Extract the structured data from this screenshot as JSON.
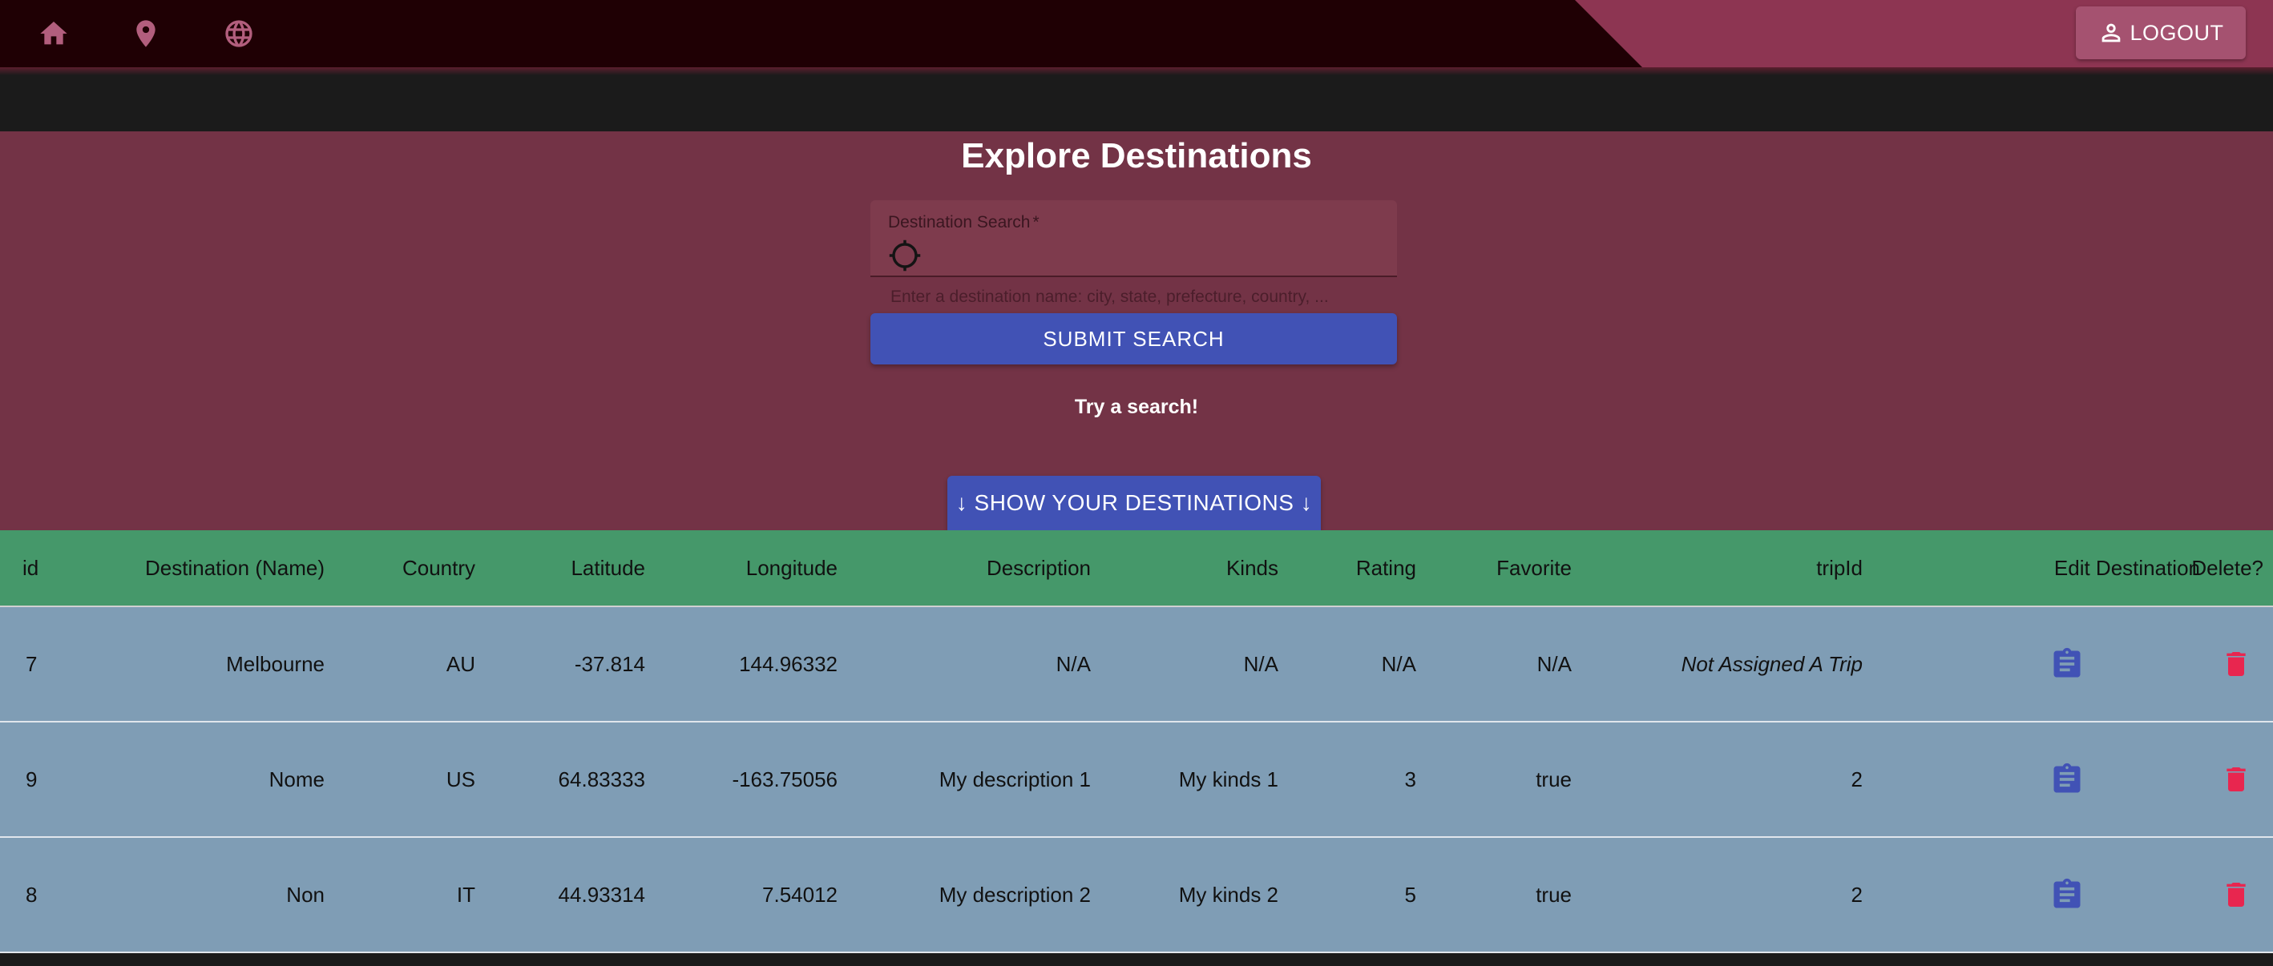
{
  "nav": {
    "icons": [
      "home-icon",
      "location-pin-icon",
      "globe-icon"
    ],
    "logout_label": "LOGOUT"
  },
  "explore": {
    "title": "Explore Destinations",
    "search": {
      "label": "Destination Search",
      "required_marker": "*",
      "value": "",
      "helper": "Enter a destination name: city, state, prefecture, country, ..."
    },
    "submit_label": "SUBMIT SEARCH",
    "status_text": "Try a search!",
    "show_button_label": "↓ SHOW YOUR DESTINATIONS ↓"
  },
  "table": {
    "headers": {
      "id": "id",
      "name": "Destination (Name)",
      "country": "Country",
      "latitude": "Latitude",
      "longitude": "Longitude",
      "description": "Description",
      "kinds": "Kinds",
      "rating": "Rating",
      "favorite": "Favorite",
      "trip": "tripId",
      "edit": "Edit Destination",
      "delete": "Delete?"
    },
    "rows": [
      {
        "id": "7",
        "name": "Melbourne",
        "country": "AU",
        "latitude": "-37.814",
        "longitude": "144.96332",
        "description": "N/A",
        "kinds": "N/A",
        "rating": "N/A",
        "favorite": "N/A",
        "trip": "Not Assigned A Trip"
      },
      {
        "id": "9",
        "name": "Nome",
        "country": "US",
        "latitude": "64.83333",
        "longitude": "-163.75056",
        "description": "My description 1",
        "kinds": "My kinds 1",
        "rating": "3",
        "favorite": "true",
        "trip": "2"
      },
      {
        "id": "8",
        "name": "Non",
        "country": "IT",
        "latitude": "44.93314",
        "longitude": "7.54012",
        "description": "My description 2",
        "kinds": "My kinds 2",
        "rating": "5",
        "favorite": "true",
        "trip": "2"
      }
    ]
  },
  "colors": {
    "appbar": "#1f0004",
    "appbar_accent": "#8d3552",
    "explore_bg": "#733346",
    "primary_button": "#4152b5",
    "table_header": "#45986a",
    "table_row": "#7f9db5",
    "delete_icon": "#e8264f"
  }
}
